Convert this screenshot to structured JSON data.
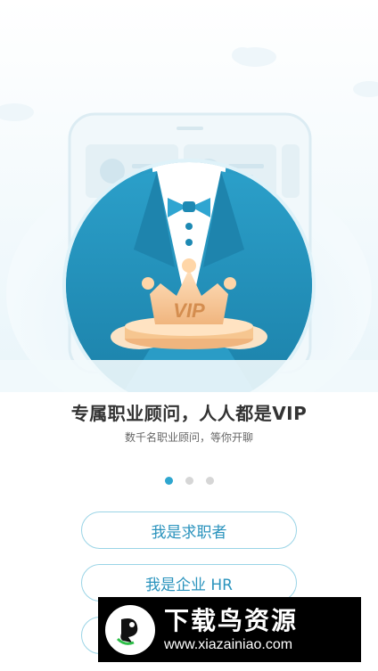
{
  "onboarding": {
    "headline": "专属职业顾问，人人都是VIP",
    "subline": "数千名职业顾问，等你开聊",
    "badge_text": "VIP",
    "pagination": {
      "total": 3,
      "active": 1
    },
    "buttons": {
      "job_seeker": "我是求职者",
      "hr": "我是企业 HR"
    }
  },
  "watermark": {
    "title": "下载鸟资源",
    "url": "www.xiazainiao.com"
  },
  "colors": {
    "accent": "#2ea6cf",
    "button_text": "#2a93bd",
    "button_border": "#9ad4e6",
    "suit": "#1f8fb8",
    "crown": "#f4c99a"
  }
}
